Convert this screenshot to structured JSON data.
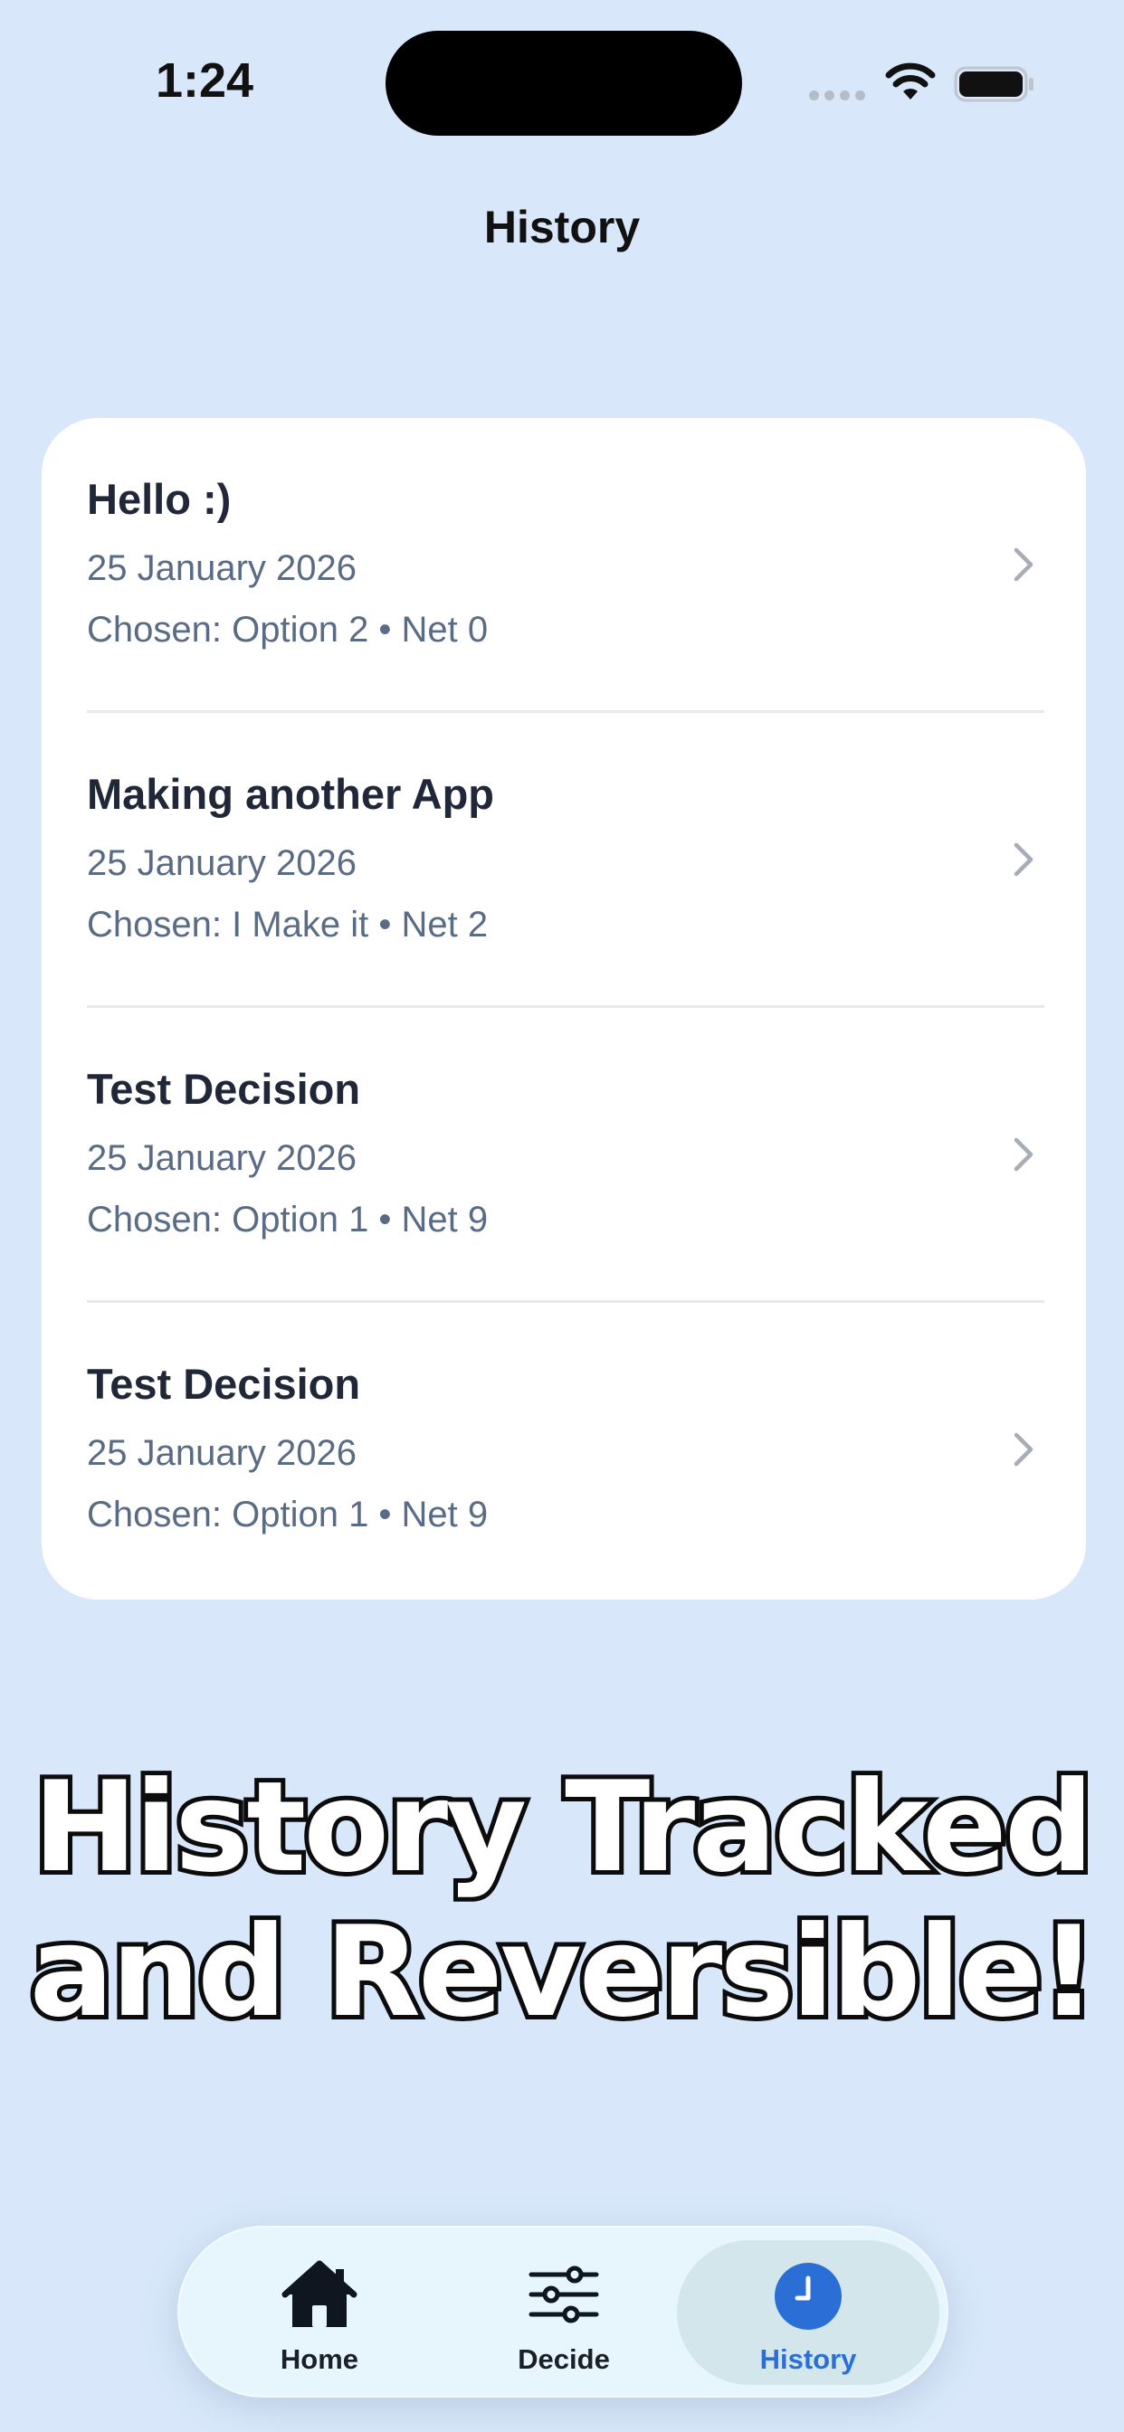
{
  "status_bar": {
    "time": "1:24"
  },
  "nav": {
    "title": "History"
  },
  "history": [
    {
      "title": "Hello :)",
      "date": "25 January 2026",
      "detail": "Chosen: Option 2 • Net 0"
    },
    {
      "title": "Making another App",
      "date": "25 January 2026",
      "detail": "Chosen: I Make it • Net 2"
    },
    {
      "title": "Test Decision",
      "date": "25 January 2026",
      "detail": "Chosen: Option 1 • Net 9"
    },
    {
      "title": "Test Decision",
      "date": "25 January 2026",
      "detail": "Chosen: Option 1 • Net 9"
    }
  ],
  "promo": {
    "line1": "History Tracked",
    "line2": "and Reversible!"
  },
  "tabs": [
    {
      "label": "Home",
      "icon": "house-icon"
    },
    {
      "label": "Decide",
      "icon": "sliders-icon"
    },
    {
      "label": "History",
      "icon": "clock-icon",
      "selected": true
    }
  ],
  "colors": {
    "background": "#d8e8fa",
    "accent": "#2b6fd6",
    "card": "#ffffff"
  }
}
